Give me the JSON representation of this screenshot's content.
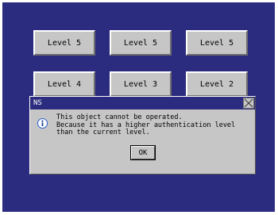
{
  "screen": {
    "buttons": [
      {
        "label": "Level 5"
      },
      {
        "label": "Level 5"
      },
      {
        "label": "Level 5"
      },
      {
        "label": "Level 4"
      },
      {
        "label": "Level 3"
      },
      {
        "label": "Level 2"
      }
    ]
  },
  "dialog": {
    "title": "NS",
    "icon": "info-icon",
    "message_lines": [
      "This object cannot be operated.",
      "Because it has a higher authentication level",
      "than the current level."
    ],
    "ok_label": "OK"
  },
  "colors": {
    "screen_background": "#2b2b7f",
    "button_face": "#c6c6c6",
    "title_bar": "#2b2b7f",
    "icon_accent": "#2a5fd0"
  }
}
